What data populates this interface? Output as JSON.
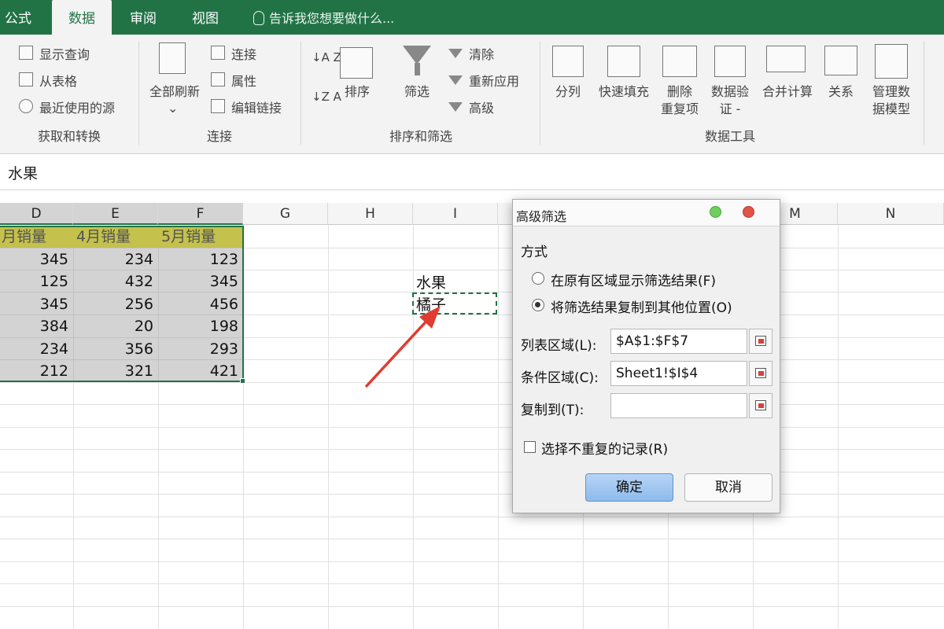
{
  "tabs": [
    {
      "label": "公式",
      "active": false
    },
    {
      "label": "数据",
      "active": true
    },
    {
      "label": "审阅",
      "active": false
    },
    {
      "label": "视图",
      "active": false
    }
  ],
  "tell_me": "告诉我您想要做什么...",
  "ribbon": {
    "get_transform": {
      "items": [
        "显示查询",
        "从表格",
        "最近使用的源"
      ],
      "label": "获取和转换"
    },
    "connections": {
      "refresh_all": "全部刷新",
      "items": [
        "连接",
        "属性",
        "编辑链接"
      ],
      "label": "连接"
    },
    "sort_filter": {
      "sort": "排序",
      "filter": "筛选",
      "items": [
        "清除",
        "重新应用",
        "高级"
      ],
      "label": "排序和筛选"
    },
    "data_tools": {
      "text_to_columns": "分列",
      "flash_fill": "快速填充",
      "remove_dup_1": "删除",
      "remove_dup_2": "重复项",
      "validation_1": "数据验",
      "validation_2": "证 -",
      "consolidate": "合并计算",
      "relationships": "关系",
      "model_1": "管理数",
      "model_2": "据模型",
      "label": "数据工具"
    }
  },
  "formula_bar": {
    "value": "水果"
  },
  "columns": [
    "D",
    "E",
    "F",
    "G",
    "H",
    "I",
    "M",
    "N"
  ],
  "table": {
    "headers": [
      "月销量",
      "4月销量",
      "5月销量"
    ],
    "rows": [
      [
        "345",
        "234",
        "123"
      ],
      [
        "125",
        "432",
        "345"
      ],
      [
        "345",
        "256",
        "456"
      ],
      [
        "384",
        "20",
        "198"
      ],
      [
        "234",
        "356",
        "293"
      ],
      [
        "212",
        "321",
        "421"
      ]
    ]
  },
  "criteria": {
    "header": "水果",
    "value": "橘子"
  },
  "dialog": {
    "title": "高级筛选",
    "section": "方式",
    "option_in_place": "在原有区域显示筛选结果(F)",
    "option_copy": "将筛选结果复制到其他位置(O)",
    "list_range_label": "列表区域(L):",
    "list_range_value": "$A$1:$F$7",
    "criteria_label": "条件区域(C):",
    "criteria_value": "Sheet1!$I$4",
    "copy_to_label": "复制到(T):",
    "copy_to_value": "",
    "unique_label": "选择不重复的记录(R)",
    "ok": "确定",
    "cancel": "取消"
  },
  "colors": {
    "excel_green": "#217346",
    "header_fill": "#e5e017",
    "arrow": "#e03c31"
  }
}
